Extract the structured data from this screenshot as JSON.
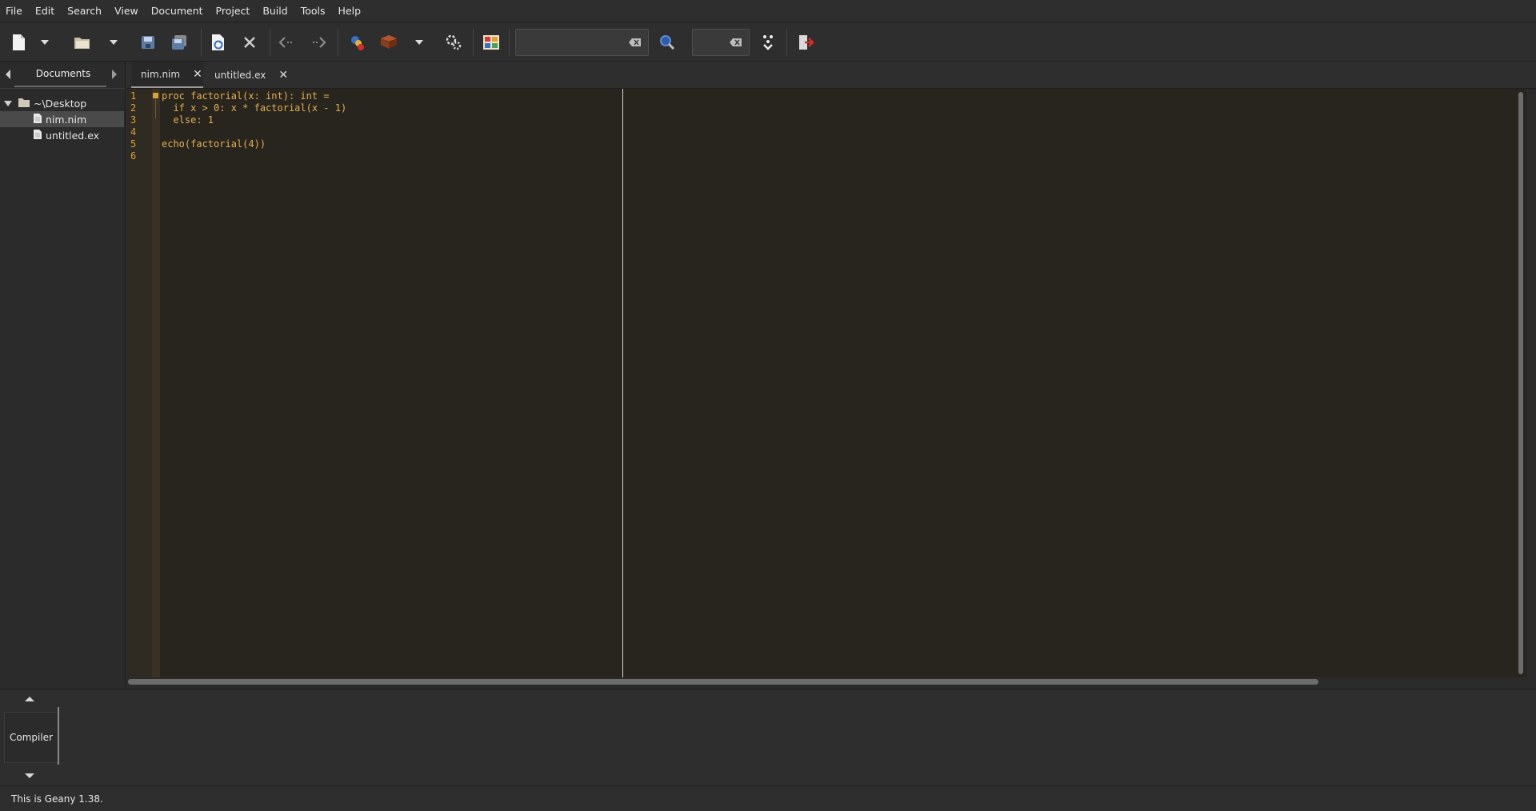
{
  "menu": {
    "items": [
      "File",
      "Edit",
      "Search",
      "View",
      "Document",
      "Project",
      "Build",
      "Tools",
      "Help"
    ]
  },
  "toolbar": {
    "buttons": [
      {
        "name": "new-file",
        "icon": "new-document-icon"
      },
      {
        "name": "new-file-dropdown",
        "icon": "chevron-down-icon"
      },
      {
        "name": "open-file",
        "icon": "folder-open-icon"
      },
      {
        "name": "open-file-dropdown",
        "icon": "chevron-down-icon"
      },
      {
        "name": "save",
        "icon": "save-icon"
      },
      {
        "name": "save-all",
        "icon": "save-all-icon"
      },
      {
        "name": "reload",
        "icon": "reload-icon"
      },
      {
        "name": "close",
        "icon": "close-icon"
      },
      {
        "name": "navigate-back",
        "icon": "arrow-left-icon"
      },
      {
        "name": "navigate-forward",
        "icon": "arrow-right-icon"
      },
      {
        "name": "compile",
        "icon": "compile-icon"
      },
      {
        "name": "build",
        "icon": "build-icon"
      },
      {
        "name": "build-dropdown",
        "icon": "chevron-down-icon"
      },
      {
        "name": "execute",
        "icon": "execute-icon"
      },
      {
        "name": "color-chooser",
        "icon": "color-chooser-icon"
      },
      {
        "name": "find",
        "icon": "search-icon"
      },
      {
        "name": "goto-line",
        "icon": "goto-icon"
      },
      {
        "name": "quit",
        "icon": "quit-icon"
      }
    ],
    "search_value": "",
    "goto_value": ""
  },
  "sidebar": {
    "tab_label": "Documents",
    "tree": [
      {
        "label": "~\\Desktop",
        "type": "folder"
      },
      {
        "label": "nim.nim",
        "type": "file",
        "selected": true
      },
      {
        "label": "untitled.ex",
        "type": "file"
      }
    ]
  },
  "editor_tabs": [
    {
      "label": "nim.nim",
      "active": true
    },
    {
      "label": "untitled.ex",
      "active": false
    }
  ],
  "editor": {
    "line_numbers": [
      "1",
      "2",
      "3",
      "4",
      "5",
      "6"
    ],
    "lines": [
      "proc factorial(x: int): int =",
      "  if x > 0: x * factorial(x - 1)",
      "  else: 1",
      "",
      "echo(factorial(4))",
      ""
    ]
  },
  "bottom_panel": {
    "tab_label": "Compiler"
  },
  "status": {
    "text": "This is Geany 1.38."
  },
  "colors": {
    "editor_bg": "#28241e",
    "code_fg": "#e2b050",
    "line_no": "#d6a23a",
    "chrome_bg": "#2e2e2e"
  }
}
